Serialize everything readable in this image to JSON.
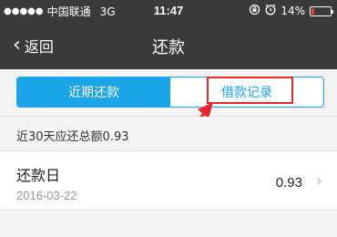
{
  "status_bar": {
    "signal_dots": "●●●●●",
    "carrier": "中国联通",
    "network": "3G",
    "time": "11:47",
    "lock_icon": "rotation-lock-icon",
    "alarm_icon": "alarm-icon",
    "battery_percent": "14%",
    "battery_level": 0.14,
    "battery_color": "#ff3b30"
  },
  "nav": {
    "back_label": "返回",
    "title": "还款"
  },
  "tabs": [
    {
      "label": "近期还款",
      "active": true
    },
    {
      "label": "借款记录",
      "active": false
    }
  ],
  "summary": {
    "text": "近30天应还总额0.93"
  },
  "list": [
    {
      "title": "还款日",
      "date": "2016-03-22",
      "amount": "0.93"
    }
  ],
  "colors": {
    "accent": "#1aa5e8",
    "nav_bg": "#3a3a3a",
    "annotation_red": "#e8262c"
  }
}
